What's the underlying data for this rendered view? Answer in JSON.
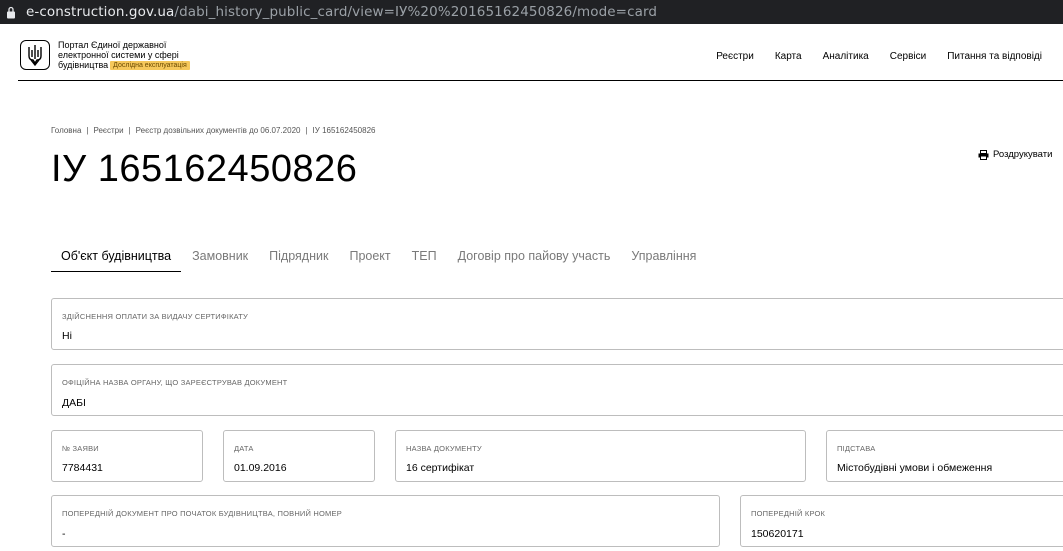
{
  "browser": {
    "url_host": "e-construction.gov.ua",
    "url_path": "/dabi_history_public_card/view=ІУ%20%20165162450826/mode=card"
  },
  "header": {
    "brand_lines": [
      "Портал Єдиної державної",
      "електронної системи у сфері",
      "будівництва"
    ],
    "beta_badge": "Дослідна експлуатація",
    "nav": [
      "Реєстри",
      "Карта",
      "Аналітика",
      "Сервіси",
      "Питання та відповіді"
    ]
  },
  "breadcrumb": [
    "Головна",
    "Реєстри",
    "Реєстр дозвільних документів до 06.07.2020",
    "ІУ 165162450826"
  ],
  "title": "ІУ 165162450826",
  "print_label": "Роздрукувати",
  "tabs": [
    "Об'єкт будівництва",
    "Замовник",
    "Підрядник",
    "Проект",
    "ТЕП",
    "Договір про пайову участь",
    "Управління"
  ],
  "fields": {
    "payment": {
      "label": "Здійснення оплати за видачу сертифікату",
      "value": "Ні"
    },
    "authority": {
      "label": "Офіційна назва органу, що зареєстрував документ",
      "value": "ДАБІ"
    },
    "application_no": {
      "label": "№ заяви",
      "value": "7784431"
    },
    "date": {
      "label": "Дата",
      "value": "01.09.2016"
    },
    "doc_name": {
      "label": "Назва документу",
      "value": "16 сертифікат"
    },
    "basis": {
      "label": "Підстава",
      "value": "Містобудівні умови і обмеження"
    },
    "prev_doc": {
      "label": "Попередній документ про початок будівництва, повний номер",
      "value": "-"
    },
    "prev_step": {
      "label": "Попередній крок",
      "value": "150620171"
    }
  },
  "colors": {
    "beta_bg": "#f5c85c",
    "url_bar": "#202124"
  }
}
